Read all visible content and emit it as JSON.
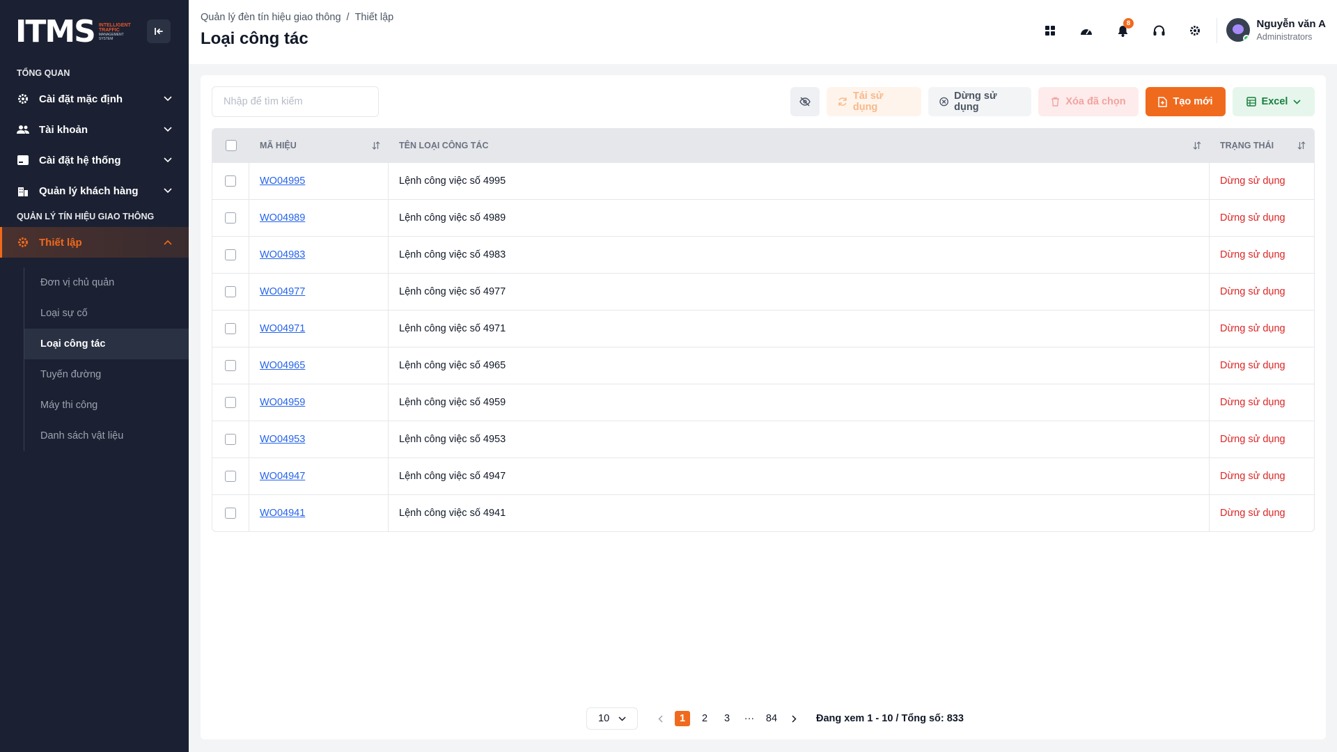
{
  "brand": {
    "logo_text": "ITMS",
    "logo_sub": [
      "INTELLIGENT",
      "TRAFFIC",
      "MANAGEMENT",
      "SYSTEM"
    ]
  },
  "sidebar": {
    "section_overview": "TỔNG QUAN",
    "items": [
      {
        "label": "Cài đặt mặc định",
        "icon": "gear-icon"
      },
      {
        "label": "Tài khoản",
        "icon": "users-icon"
      },
      {
        "label": "Cài đặt hệ thống",
        "icon": "card-icon"
      },
      {
        "label": "Quản lý khách hàng",
        "icon": "building-icon"
      }
    ],
    "section_traffic": "QUẢN LÝ TÍN HIỆU GIAO THÔNG",
    "active_item": {
      "label": "Thiết lập",
      "icon": "gear-icon"
    },
    "submenu": [
      "Đơn vị chủ quản",
      "Loại sự cố",
      "Loại công tác",
      "Tuyến đường",
      "Máy thi công",
      "Danh sách vật liệu"
    ]
  },
  "header": {
    "breadcrumb_parent": "Quản lý đèn tín hiệu giao thông",
    "breadcrumb_sep": "/",
    "breadcrumb_current": "Thiết lập",
    "title": "Loại công tác",
    "notification_count": "8",
    "user_name": "Nguyễn văn A",
    "user_role": "Administrators"
  },
  "toolbar": {
    "search_placeholder": "Nhập để tìm kiếm",
    "reuse_label": "Tái sử dụng",
    "stop_label": "Dừng sử dụng",
    "delete_label": "Xóa đã chọn",
    "new_label": "Tạo mới",
    "excel_label": "Excel"
  },
  "table": {
    "columns": {
      "code": "MÃ HIỆU",
      "name": "TÊN LOẠI CÔNG TÁC",
      "status": "TRẠNG THÁI"
    },
    "rows": [
      {
        "code": "WO04995",
        "name": "Lệnh công việc số 4995",
        "status": "Dừng sử dụng"
      },
      {
        "code": "WO04989",
        "name": "Lệnh công việc số 4989",
        "status": "Dừng sử dụng"
      },
      {
        "code": "WO04983",
        "name": "Lệnh công việc số 4983",
        "status": "Dừng sử dụng"
      },
      {
        "code": "WO04977",
        "name": "Lệnh công việc số 4977",
        "status": "Dừng sử dụng"
      },
      {
        "code": "WO04971",
        "name": "Lệnh công việc số 4971",
        "status": "Dừng sử dụng"
      },
      {
        "code": "WO04965",
        "name": "Lệnh công việc số 4965",
        "status": "Dừng sử dụng"
      },
      {
        "code": "WO04959",
        "name": "Lệnh công việc số 4959",
        "status": "Dừng sử dụng"
      },
      {
        "code": "WO04953",
        "name": "Lệnh công việc số 4953",
        "status": "Dừng sử dụng"
      },
      {
        "code": "WO04947",
        "name": "Lệnh công việc số 4947",
        "status": "Dừng sử dụng"
      },
      {
        "code": "WO04941",
        "name": "Lệnh công việc số 4941",
        "status": "Dừng sử dụng"
      }
    ]
  },
  "pagination": {
    "page_size": "10",
    "pages": [
      "1",
      "2",
      "3"
    ],
    "ellipsis": "···",
    "last_page": "84",
    "info": "Đang xem 1 - 10 / Tổng số: 833"
  },
  "colors": {
    "accent": "#f06a1d",
    "sidebar_bg": "#1b2132",
    "status_red": "#dc2626",
    "link_blue": "#2563eb",
    "excel_green": "#16803c"
  }
}
